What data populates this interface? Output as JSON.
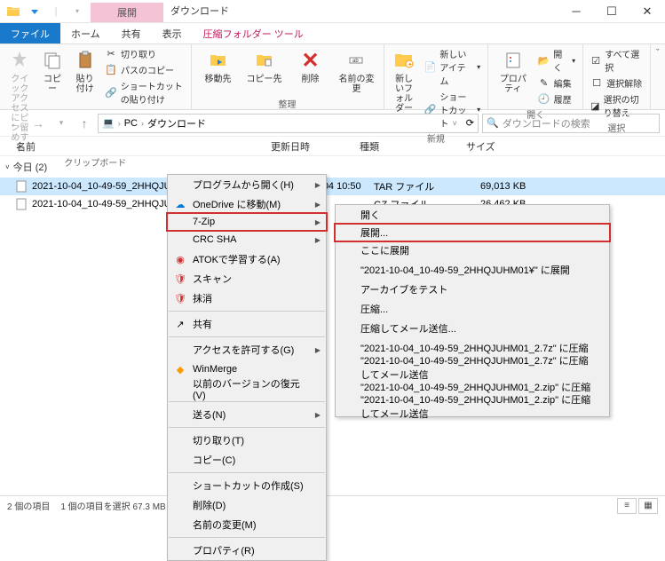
{
  "titlebar": {
    "contextual_tab": "展開",
    "window_title": "ダウンロード"
  },
  "tabs": {
    "file": "ファイル",
    "home": "ホーム",
    "share": "共有",
    "view": "表示",
    "contextual": "圧縮フォルダー ツール"
  },
  "ribbon": {
    "clipboard": {
      "quick_access": "クイック アクセスにピン留めする",
      "copy": "コピー",
      "paste": "貼り付け",
      "cut": "切り取り",
      "copy_path": "パスのコピー",
      "paste_shortcut": "ショートカットの貼り付け",
      "group": "クリップボード"
    },
    "organize": {
      "move_to": "移動先",
      "copy_to": "コピー先",
      "delete": "削除",
      "rename": "名前の変更",
      "group": "整理"
    },
    "new": {
      "new_folder": "新しいフォルダー",
      "new_item": "新しいアイテム",
      "shortcut": "ショートカット",
      "group": "新規"
    },
    "open": {
      "properties": "プロパティ",
      "open": "開く",
      "edit": "編集",
      "history": "履歴",
      "group": "開く"
    },
    "select": {
      "select_all": "すべて選択",
      "select_none": "選択解除",
      "invert": "選択の切り替え",
      "group": "選択"
    }
  },
  "address": {
    "crumbs": [
      "PC",
      "ダウンロード"
    ],
    "search_placeholder": "ダウンロードの検索"
  },
  "columns": {
    "name": "名前",
    "date": "更新日時",
    "type": "種類",
    "size": "サイズ"
  },
  "group_header": "今日 (2)",
  "files": [
    {
      "name": "2021-10-04_10-49-59_2HHQJUHM01.tar",
      "date": "2021/10/04 10:50",
      "type": "TAR ファイル",
      "size": "69,013 KB",
      "selected": true
    },
    {
      "name": "2021-10-04_10-49-59_2HHQJUHM01.tar.gz",
      "date": "",
      "type": "GZ ファイル",
      "size": "26,462 KB",
      "selected": false
    }
  ],
  "ctx1": {
    "open_with": "プログラムから開く(H)",
    "onedrive": "OneDrive に移動(M)",
    "seven_zip": "7-Zip",
    "crc_sha": "CRC SHA",
    "atok": "ATOKで学習する(A)",
    "scan": "スキャン",
    "shred": "抹消",
    "share": "共有",
    "access": "アクセスを許可する(G)",
    "winmerge": "WinMerge",
    "restore": "以前のバージョンの復元(V)",
    "send_to": "送る(N)",
    "cut": "切り取り(T)",
    "copy": "コピー(C)",
    "create_shortcut": "ショートカットの作成(S)",
    "delete": "削除(D)",
    "rename": "名前の変更(M)",
    "properties": "プロパティ(R)"
  },
  "ctx2": {
    "open": "開く",
    "extract": "展開...",
    "extract_here": "ここに展開",
    "extract_to": "\"2021-10-04_10-49-59_2HHQJUHM01¥\" に展開",
    "test": "アーカイブをテスト",
    "compress": "圧縮...",
    "compress_mail": "圧縮してメール送信...",
    "to_7z": "\"2021-10-04_10-49-59_2HHQJUHM01_2.7z\" に圧縮",
    "to_7z_mail": "\"2021-10-04_10-49-59_2HHQJUHM01_2.7z\" に圧縮してメール送信",
    "to_zip": "\"2021-10-04_10-49-59_2HHQJUHM01_2.zip\" に圧縮",
    "to_zip_mail": "\"2021-10-04_10-49-59_2HHQJUHM01_2.zip\" に圧縮してメール送信"
  },
  "status": {
    "count": "2 個の項目",
    "selection": "1 個の項目を選択 67.3 MB"
  }
}
